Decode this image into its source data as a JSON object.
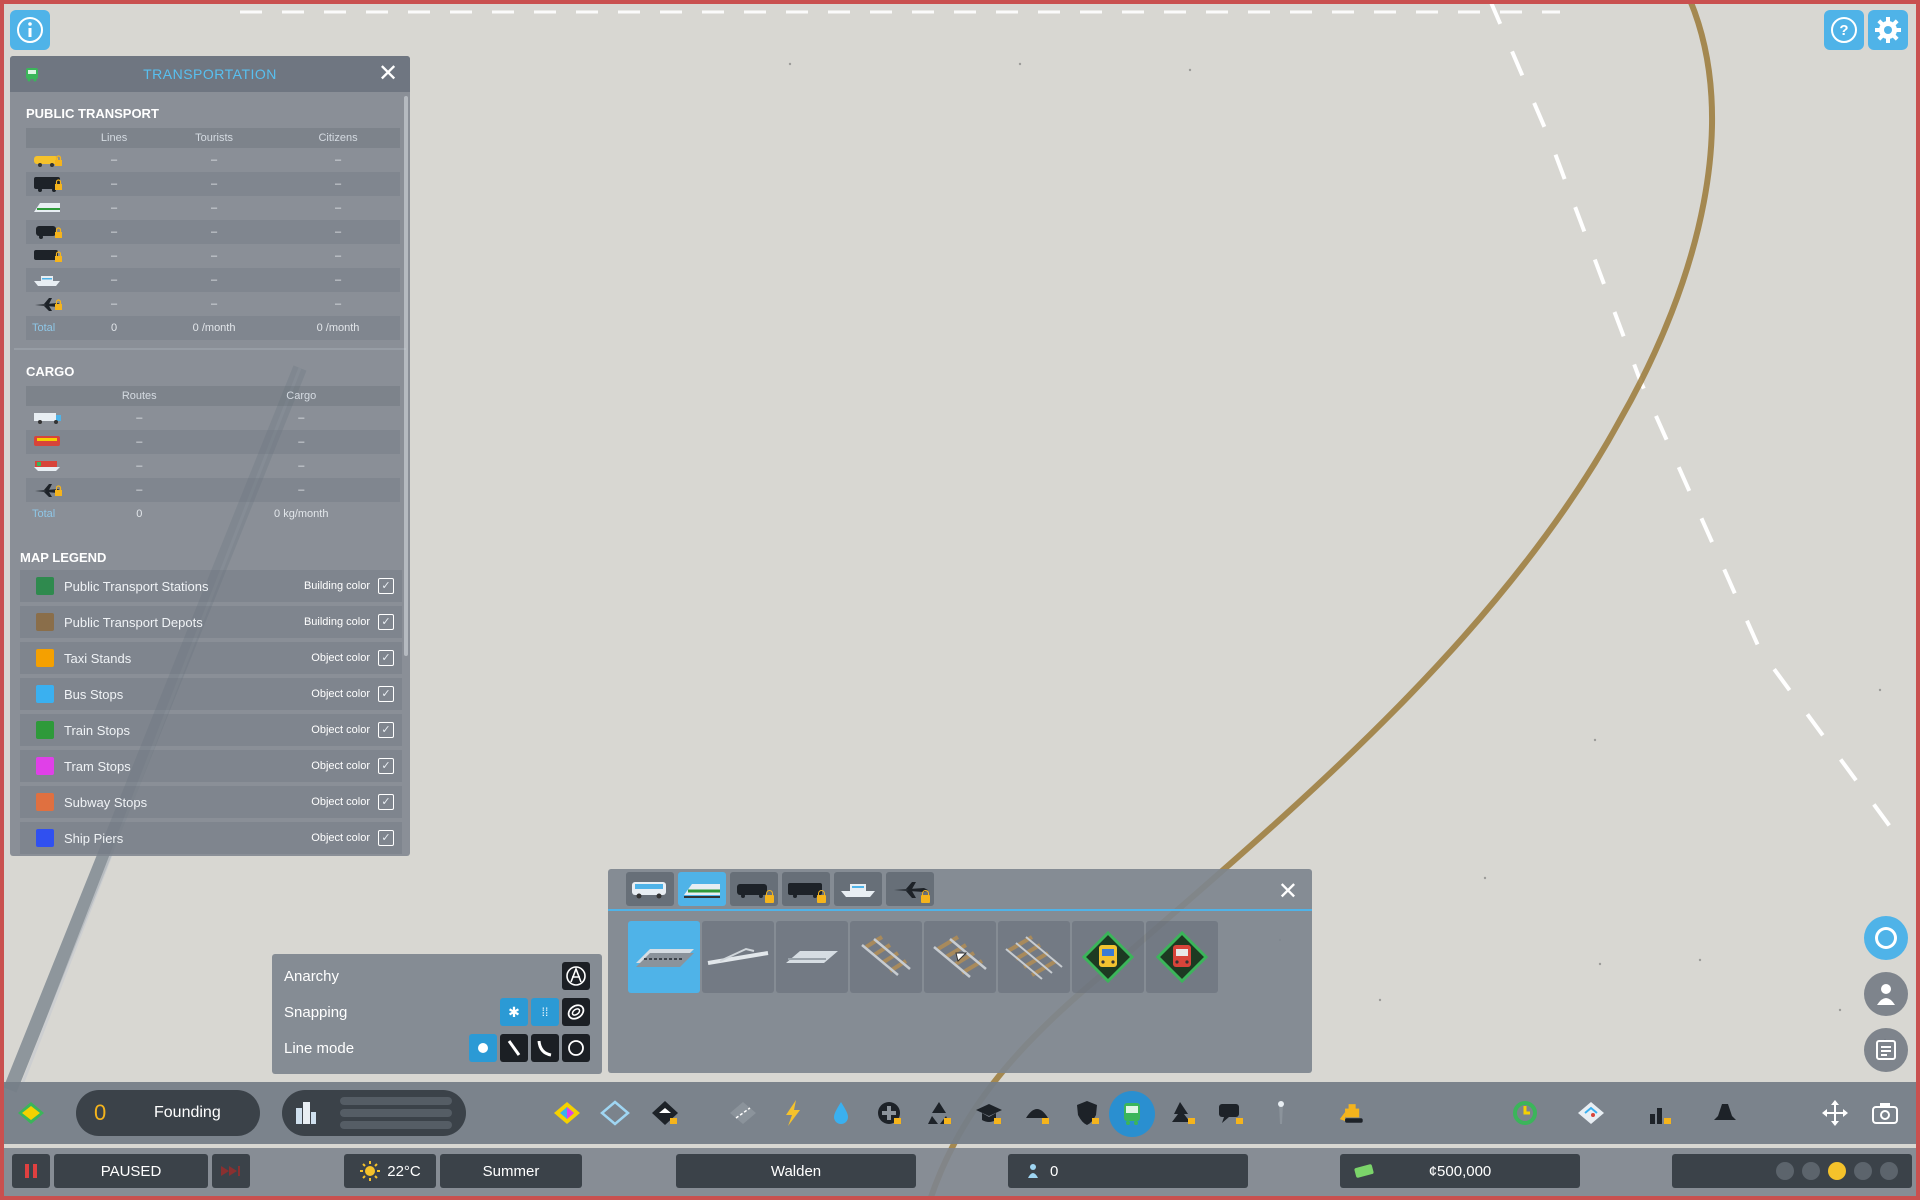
{
  "panel": {
    "title": "TRANSPORTATION",
    "public_transport": {
      "heading": "PUBLIC TRANSPORT",
      "columns": [
        "Lines",
        "Tourists",
        "Citizens"
      ],
      "rows": [
        {
          "icon": "taxi-icon",
          "locked": true,
          "values": [
            "–",
            "–",
            "–"
          ]
        },
        {
          "icon": "bus-icon",
          "locked": true,
          "values": [
            "–",
            "–",
            "–"
          ]
        },
        {
          "icon": "train-icon",
          "locked": false,
          "values": [
            "–",
            "–",
            "–"
          ]
        },
        {
          "icon": "tram-icon",
          "locked": true,
          "values": [
            "–",
            "–",
            "–"
          ]
        },
        {
          "icon": "subway-icon",
          "locked": true,
          "values": [
            "–",
            "–",
            "–"
          ]
        },
        {
          "icon": "ship-icon",
          "locked": false,
          "values": [
            "–",
            "–",
            "–"
          ]
        },
        {
          "icon": "airplane-icon",
          "locked": true,
          "values": [
            "–",
            "–",
            "–"
          ]
        }
      ],
      "total": {
        "label": "Total",
        "values": [
          "0",
          "0 /month",
          "0 /month"
        ]
      }
    },
    "cargo": {
      "heading": "CARGO",
      "columns": [
        "Routes",
        "Cargo"
      ],
      "rows": [
        {
          "icon": "cargo-truck-icon",
          "locked": false,
          "values": [
            "–",
            "–"
          ]
        },
        {
          "icon": "cargo-train-icon",
          "locked": false,
          "values": [
            "–",
            "–"
          ]
        },
        {
          "icon": "cargo-ship-icon",
          "locked": false,
          "values": [
            "–",
            "–"
          ]
        },
        {
          "icon": "cargo-plane-icon",
          "locked": true,
          "values": [
            "–",
            "–"
          ]
        }
      ],
      "total": {
        "label": "Total",
        "values": [
          "0",
          "0 kg/month"
        ]
      }
    },
    "legend": {
      "heading": "MAP LEGEND",
      "items": [
        {
          "label": "Public Transport Stations",
          "mode": "Building color",
          "color": "#2f8a4e"
        },
        {
          "label": "Public Transport Depots",
          "mode": "Building color",
          "color": "#8a6e4a"
        },
        {
          "label": "Taxi Stands",
          "mode": "Object color",
          "color": "#f5a000"
        },
        {
          "label": "Bus Stops",
          "mode": "Object color",
          "color": "#3ab0f0"
        },
        {
          "label": "Train Stops",
          "mode": "Object color",
          "color": "#2e9a3a"
        },
        {
          "label": "Tram Stops",
          "mode": "Object color",
          "color": "#e040e8"
        },
        {
          "label": "Subway Stops",
          "mode": "Object color",
          "color": "#e07040"
        },
        {
          "label": "Ship Piers",
          "mode": "Object color",
          "color": "#3050f0"
        }
      ]
    }
  },
  "tool_options": {
    "anarchy": "Anarchy",
    "snapping": "Snapping",
    "line_mode": "Line mode"
  },
  "top": {
    "info_icon": "info-icon",
    "help_icon": "help-icon",
    "settings_icon": "gear-icon"
  },
  "toolbar": {
    "milestone_value": "0",
    "milestone_label": "Founding",
    "active_tool": "transportation"
  },
  "status": {
    "paused": "PAUSED",
    "temperature": "22°C",
    "season": "Summer",
    "city": "Walden",
    "population": "0",
    "money": "¢500,000"
  },
  "colors": {
    "accent": "#4fb3e8",
    "panel": "#7e858e",
    "lock": "#f5b41c"
  }
}
